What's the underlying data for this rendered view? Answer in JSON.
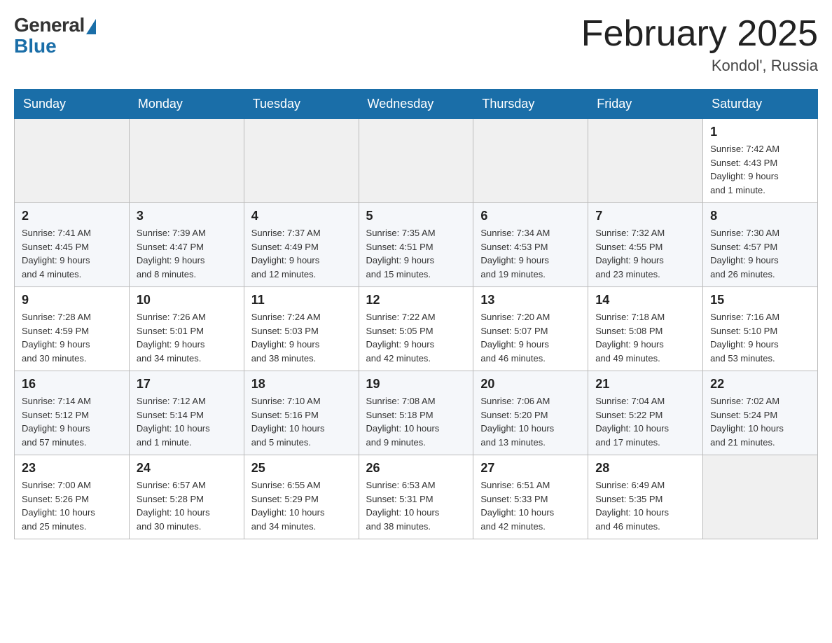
{
  "header": {
    "logo_general": "General",
    "logo_blue": "Blue",
    "title": "February 2025",
    "location": "Kondol', Russia"
  },
  "days_of_week": [
    "Sunday",
    "Monday",
    "Tuesday",
    "Wednesday",
    "Thursday",
    "Friday",
    "Saturday"
  ],
  "weeks": [
    [
      {
        "day": "",
        "info": ""
      },
      {
        "day": "",
        "info": ""
      },
      {
        "day": "",
        "info": ""
      },
      {
        "day": "",
        "info": ""
      },
      {
        "day": "",
        "info": ""
      },
      {
        "day": "",
        "info": ""
      },
      {
        "day": "1",
        "info": "Sunrise: 7:42 AM\nSunset: 4:43 PM\nDaylight: 9 hours\nand 1 minute."
      }
    ],
    [
      {
        "day": "2",
        "info": "Sunrise: 7:41 AM\nSunset: 4:45 PM\nDaylight: 9 hours\nand 4 minutes."
      },
      {
        "day": "3",
        "info": "Sunrise: 7:39 AM\nSunset: 4:47 PM\nDaylight: 9 hours\nand 8 minutes."
      },
      {
        "day": "4",
        "info": "Sunrise: 7:37 AM\nSunset: 4:49 PM\nDaylight: 9 hours\nand 12 minutes."
      },
      {
        "day": "5",
        "info": "Sunrise: 7:35 AM\nSunset: 4:51 PM\nDaylight: 9 hours\nand 15 minutes."
      },
      {
        "day": "6",
        "info": "Sunrise: 7:34 AM\nSunset: 4:53 PM\nDaylight: 9 hours\nand 19 minutes."
      },
      {
        "day": "7",
        "info": "Sunrise: 7:32 AM\nSunset: 4:55 PM\nDaylight: 9 hours\nand 23 minutes."
      },
      {
        "day": "8",
        "info": "Sunrise: 7:30 AM\nSunset: 4:57 PM\nDaylight: 9 hours\nand 26 minutes."
      }
    ],
    [
      {
        "day": "9",
        "info": "Sunrise: 7:28 AM\nSunset: 4:59 PM\nDaylight: 9 hours\nand 30 minutes."
      },
      {
        "day": "10",
        "info": "Sunrise: 7:26 AM\nSunset: 5:01 PM\nDaylight: 9 hours\nand 34 minutes."
      },
      {
        "day": "11",
        "info": "Sunrise: 7:24 AM\nSunset: 5:03 PM\nDaylight: 9 hours\nand 38 minutes."
      },
      {
        "day": "12",
        "info": "Sunrise: 7:22 AM\nSunset: 5:05 PM\nDaylight: 9 hours\nand 42 minutes."
      },
      {
        "day": "13",
        "info": "Sunrise: 7:20 AM\nSunset: 5:07 PM\nDaylight: 9 hours\nand 46 minutes."
      },
      {
        "day": "14",
        "info": "Sunrise: 7:18 AM\nSunset: 5:08 PM\nDaylight: 9 hours\nand 49 minutes."
      },
      {
        "day": "15",
        "info": "Sunrise: 7:16 AM\nSunset: 5:10 PM\nDaylight: 9 hours\nand 53 minutes."
      }
    ],
    [
      {
        "day": "16",
        "info": "Sunrise: 7:14 AM\nSunset: 5:12 PM\nDaylight: 9 hours\nand 57 minutes."
      },
      {
        "day": "17",
        "info": "Sunrise: 7:12 AM\nSunset: 5:14 PM\nDaylight: 10 hours\nand 1 minute."
      },
      {
        "day": "18",
        "info": "Sunrise: 7:10 AM\nSunset: 5:16 PM\nDaylight: 10 hours\nand 5 minutes."
      },
      {
        "day": "19",
        "info": "Sunrise: 7:08 AM\nSunset: 5:18 PM\nDaylight: 10 hours\nand 9 minutes."
      },
      {
        "day": "20",
        "info": "Sunrise: 7:06 AM\nSunset: 5:20 PM\nDaylight: 10 hours\nand 13 minutes."
      },
      {
        "day": "21",
        "info": "Sunrise: 7:04 AM\nSunset: 5:22 PM\nDaylight: 10 hours\nand 17 minutes."
      },
      {
        "day": "22",
        "info": "Sunrise: 7:02 AM\nSunset: 5:24 PM\nDaylight: 10 hours\nand 21 minutes."
      }
    ],
    [
      {
        "day": "23",
        "info": "Sunrise: 7:00 AM\nSunset: 5:26 PM\nDaylight: 10 hours\nand 25 minutes."
      },
      {
        "day": "24",
        "info": "Sunrise: 6:57 AM\nSunset: 5:28 PM\nDaylight: 10 hours\nand 30 minutes."
      },
      {
        "day": "25",
        "info": "Sunrise: 6:55 AM\nSunset: 5:29 PM\nDaylight: 10 hours\nand 34 minutes."
      },
      {
        "day": "26",
        "info": "Sunrise: 6:53 AM\nSunset: 5:31 PM\nDaylight: 10 hours\nand 38 minutes."
      },
      {
        "day": "27",
        "info": "Sunrise: 6:51 AM\nSunset: 5:33 PM\nDaylight: 10 hours\nand 42 minutes."
      },
      {
        "day": "28",
        "info": "Sunrise: 6:49 AM\nSunset: 5:35 PM\nDaylight: 10 hours\nand 46 minutes."
      },
      {
        "day": "",
        "info": ""
      }
    ]
  ]
}
